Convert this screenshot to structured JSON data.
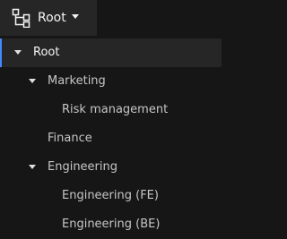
{
  "header": {
    "icon": "tree-view-icon",
    "title": "Root",
    "menu": "caret-down-icon"
  },
  "tree": {
    "nodes": [
      {
        "label": "Root",
        "expanded": true,
        "selected": true
      },
      {
        "label": "Marketing",
        "expanded": true,
        "selected": false
      },
      {
        "label": "Risk management",
        "expanded": false,
        "selected": false
      },
      {
        "label": "Finance",
        "expanded": false,
        "selected": false
      },
      {
        "label": "Engineering",
        "expanded": true,
        "selected": false
      },
      {
        "label": "Engineering (FE)",
        "expanded": false,
        "selected": false
      },
      {
        "label": "Engineering (BE)",
        "expanded": false,
        "selected": false
      }
    ]
  },
  "colors": {
    "background": "#161616",
    "header_trigger": "#262626",
    "selected_row": "#262626",
    "selected_indicator": "#4589ff",
    "text": "#f4f4f4",
    "text_secondary": "#c6c6c6"
  }
}
